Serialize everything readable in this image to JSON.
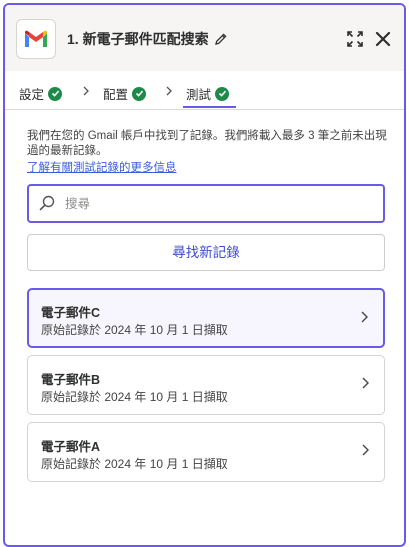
{
  "header": {
    "title": "1. 新電子郵件匹配搜索"
  },
  "tabs": [
    {
      "label": "設定",
      "completed": true
    },
    {
      "label": "配置",
      "completed": true
    },
    {
      "label": "測試",
      "completed": true,
      "active": true
    }
  ],
  "info": {
    "text": "我們在您的 Gmail 帳戶中找到了記錄。我們將載入最多 3 筆之前未出現過的最新記錄。",
    "link_label": "了解有關測試記錄的更多信息"
  },
  "search": {
    "placeholder": "搜尋",
    "value": ""
  },
  "find_button_label": "尋找新記錄",
  "records": [
    {
      "title": "電子郵件C",
      "subtitle": "原始記錄於 2024 年 10 月 1 日擷取",
      "selected": true
    },
    {
      "title": "電子郵件B",
      "subtitle": "原始記錄於 2024 年 10 月 1 日擷取",
      "selected": false
    },
    {
      "title": "電子郵件A",
      "subtitle": "原始記錄於 2024 年 10 月 1 日擷取",
      "selected": false
    }
  ],
  "colors": {
    "accent": "#695be8",
    "success": "#1d8a4b",
    "link": "#3c5bd9"
  },
  "icons": [
    "gmail-logo",
    "pencil-icon",
    "expand-icon",
    "close-icon",
    "check-icon",
    "chevron-right-icon",
    "search-icon"
  ]
}
